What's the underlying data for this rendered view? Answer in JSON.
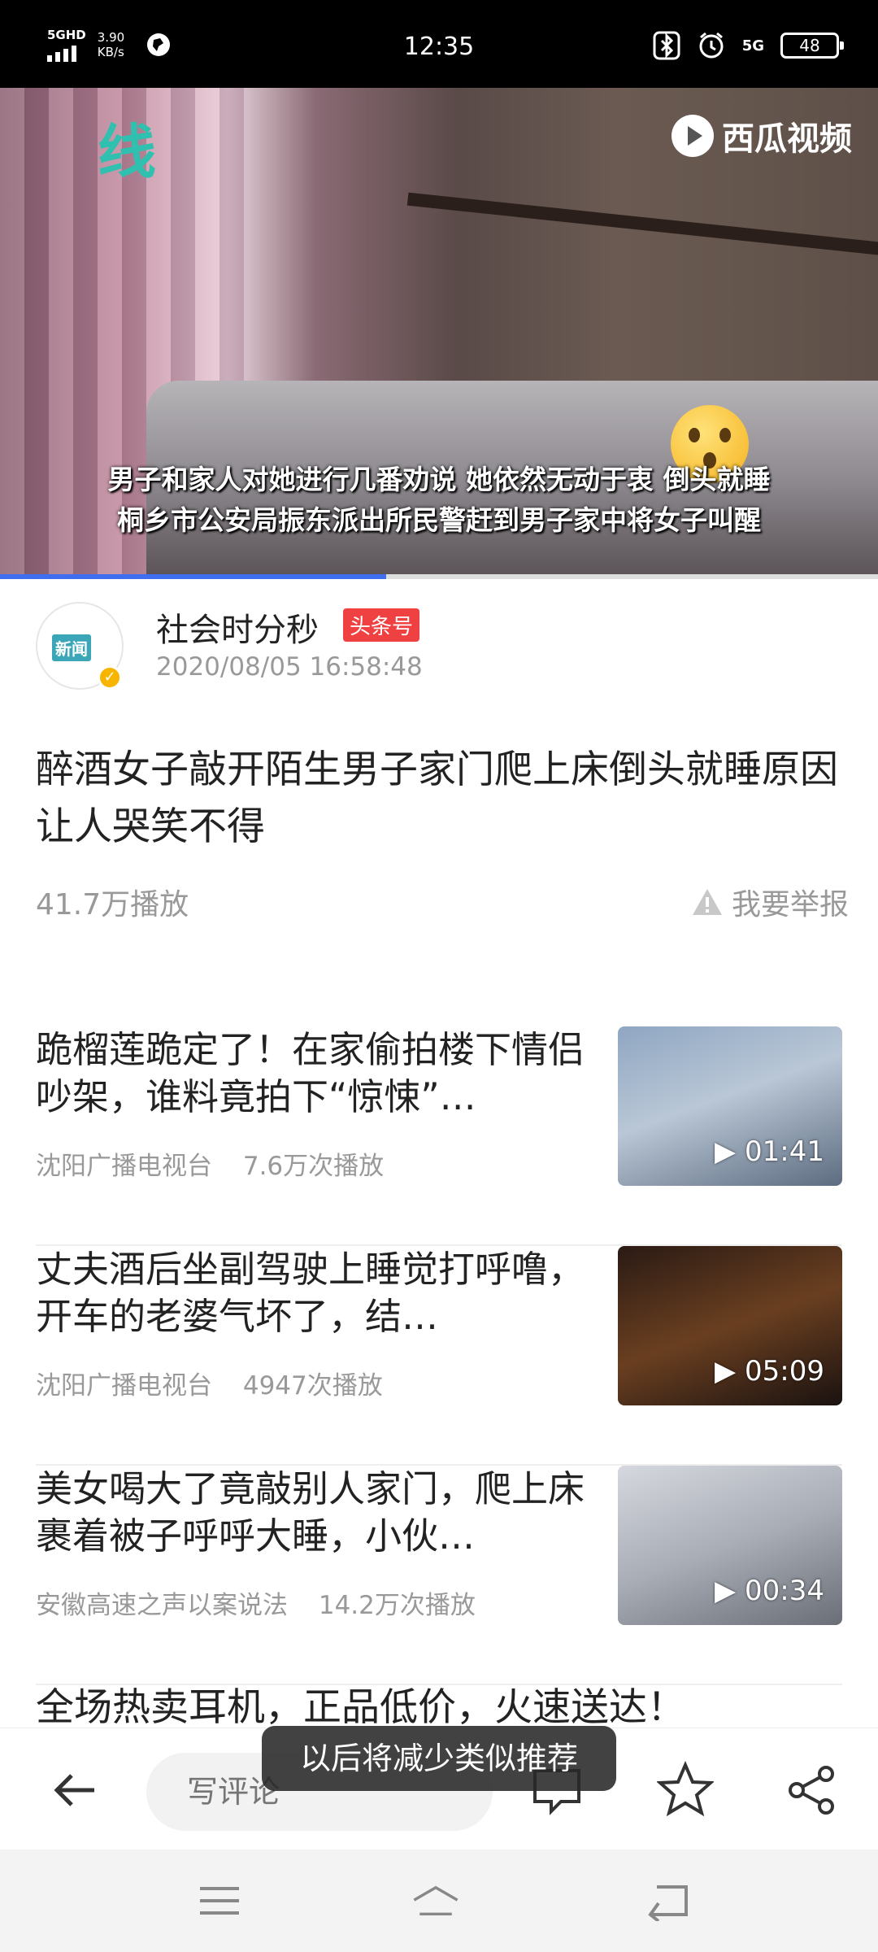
{
  "status_bar": {
    "network": "5GHD",
    "speed_value": "3.90",
    "speed_unit": "KB/s",
    "time": "12:35",
    "network_right": "5G",
    "battery": "48"
  },
  "video": {
    "watermark": "西瓜视频",
    "logo_text": "线",
    "subtitle_line1": "男子和家人对她进行几番劝说 她依然无动于衷 倒头就睡",
    "subtitle_line2": "桐乡市公安局振东派出所民警赶到男子家中将女子叫醒",
    "progress_fraction": 0.44
  },
  "author": {
    "avatar_text": "新闻",
    "name": "社会时分秒",
    "tag": "头条号",
    "date": "2020/08/05 16:58:48"
  },
  "article": {
    "title": "醉酒女子敲开陌生男子家门爬上床倒头就睡原因让人哭笑不得",
    "plays": "41.7万播放",
    "report": "我要举报"
  },
  "related": [
    {
      "title": "跪榴莲跪定了！在家偷拍楼下情侣吵架，谁料竟拍下“惊悚”…",
      "source": "沈阳广播电视台",
      "plays": "7.6万次播放",
      "duration": "01:41"
    },
    {
      "title": "丈夫酒后坐副驾驶上睡觉打呼噜，开车的老婆气坏了，结…",
      "source": "沈阳广播电视台",
      "plays": "4947次播放",
      "duration": "05:09"
    },
    {
      "title": "美女喝大了竟敲别人家门，爬上床裹着被子呼呼大睡，小伙…",
      "source": "安徽高速之声以案说法",
      "plays": "14.2万次播放",
      "duration": "00:34"
    }
  ],
  "ad": {
    "title": "全场热卖耳机，正品低价，火速送达！"
  },
  "toast": "以后将减少类似推荐",
  "bottom_bar": {
    "comment_placeholder": "写评论",
    "icons": [
      "back-arrow-icon",
      "comment-icon",
      "star-icon",
      "share-icon"
    ]
  },
  "nav_bar": {
    "icons": [
      "menu-icon",
      "home-icon",
      "back-icon"
    ]
  },
  "colors": {
    "accent": "#3f6ff0",
    "tag_red": "#f04142",
    "verify": "#f7b500"
  }
}
